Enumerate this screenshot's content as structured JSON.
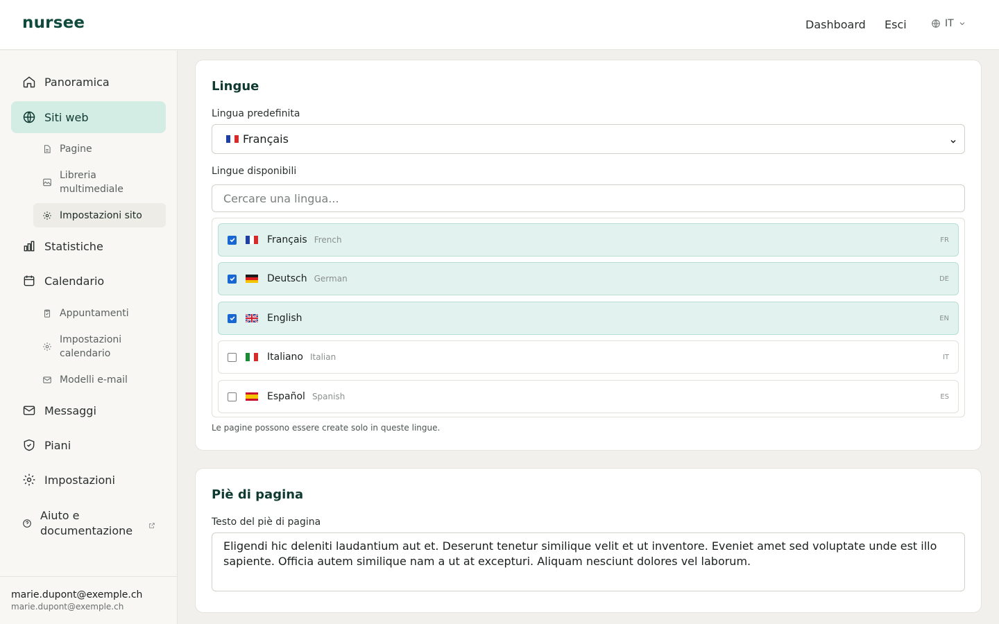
{
  "header": {
    "logo": "nursee",
    "nav": [
      "Dashboard",
      "Esci"
    ],
    "language": "IT"
  },
  "sidebar": {
    "items": {
      "overview": "Panoramica",
      "websites": "Siti web",
      "pages": "Pagine",
      "media": "Libreria multimediale",
      "site_settings": "Impostazioni sito",
      "stats": "Statistiche",
      "calendar": "Calendario",
      "appointments": "Appuntamenti",
      "calendar_settings": "Impostazioni calendario",
      "email_templates": "Modelli e-mail",
      "messages": "Messaggi",
      "plans": "Piani",
      "settings": "Impostazioni",
      "help": "Aiuto e documentazione"
    },
    "user": {
      "name": "marie.dupont@exemple.ch",
      "email": "marie.dupont@exemple.ch"
    }
  },
  "languages_card": {
    "title": "Lingue",
    "default_label": "Lingua predefinita",
    "default_value": "Français",
    "available_label": "Lingue disponibili",
    "search_placeholder": "Cercare una lingua...",
    "hint": "Le pagine possono essere create solo in queste lingue.",
    "list": [
      {
        "native": "Français",
        "english": "French",
        "code": "FR",
        "checked": true
      },
      {
        "native": "Deutsch",
        "english": "German",
        "code": "DE",
        "checked": true
      },
      {
        "native": "English",
        "english": "",
        "code": "EN",
        "checked": true
      },
      {
        "native": "Italiano",
        "english": "Italian",
        "code": "IT",
        "checked": false
      },
      {
        "native": "Español",
        "english": "Spanish",
        "code": "ES",
        "checked": false
      }
    ]
  },
  "footer_card": {
    "title": "Piè di pagina",
    "text_label": "Testo del piè di pagina",
    "text_value": "Eligendi hic deleniti laudantium aut et. Deserunt tenetur similique velit et ut inventore. Eveniet amet sed voluptate unde est illo sapiente. Officia autem similique nam a ut at excepturi. Aliquam nesciunt dolores vel laborum."
  },
  "colors": {
    "brand": "#0f4a3c",
    "active_nav": "#d3ece4",
    "checked_row": "#e2f2ee",
    "checkbox": "#1967d2"
  }
}
